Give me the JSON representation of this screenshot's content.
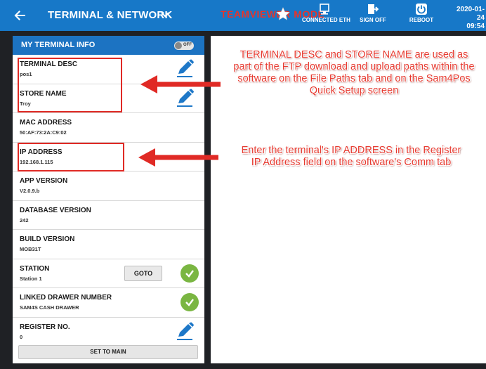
{
  "header": {
    "title": "TERMINAL & NETWORK",
    "overlay_text": "TEAMVIEWER MODE",
    "buttons": [
      {
        "label": "CONNECTED ETH",
        "icon": "ethernet-icon"
      },
      {
        "label": "SIGN OFF",
        "icon": "sign-off-icon"
      },
      {
        "label": "REBOOT",
        "icon": "power-icon"
      }
    ],
    "date": "2020-01-24",
    "time": "09:54"
  },
  "panel": {
    "title": "MY TERMINAL INFO",
    "toggle_label": "OFF",
    "rows": [
      {
        "label": "TERMINAL DESC",
        "value": "pos1",
        "action": "pencil-icon"
      },
      {
        "label": "STORE NAME",
        "value": "Troy",
        "action": "pencil-icon"
      },
      {
        "label": "MAC ADDRESS",
        "value": "50:AF:73:2A:C9:02"
      },
      {
        "label": "IP ADDRESS",
        "value": "192.168.1.115"
      },
      {
        "label": "APP VERSION",
        "value": "V2.0.9.b"
      },
      {
        "label": "DATABASE VERSION",
        "value": "242"
      },
      {
        "label": "BUILD VERSION",
        "value": "MOB31T"
      },
      {
        "label": "STATION",
        "value": "Station 1",
        "button": "GOTO",
        "action": "check-icon"
      },
      {
        "label": "LINKED DRAWER NUMBER",
        "value": "SAM4S CASH DRAWER",
        "action": "check-icon"
      },
      {
        "label": "REGISTER NO.",
        "value": "0",
        "action": "pencil-icon"
      }
    ],
    "footer_button": "SET TO MAIN"
  },
  "annotations": {
    "note1": "TERMINAL DESC and STORE NAME are used as part of the FTP download and upload paths within the software on the File Paths tab and on the Sam4Pos Quick Setup screen",
    "note2": "Enter the terminal's IP ADDRESS in the Register IP Address field on the software's Comm tab"
  },
  "colors": {
    "header_blue": "#1778c8",
    "panel_head_blue": "#1c73c2",
    "annotation_red": "#e02a25",
    "check_green": "#7ab642",
    "pencil_blue": "#1e78c8"
  }
}
